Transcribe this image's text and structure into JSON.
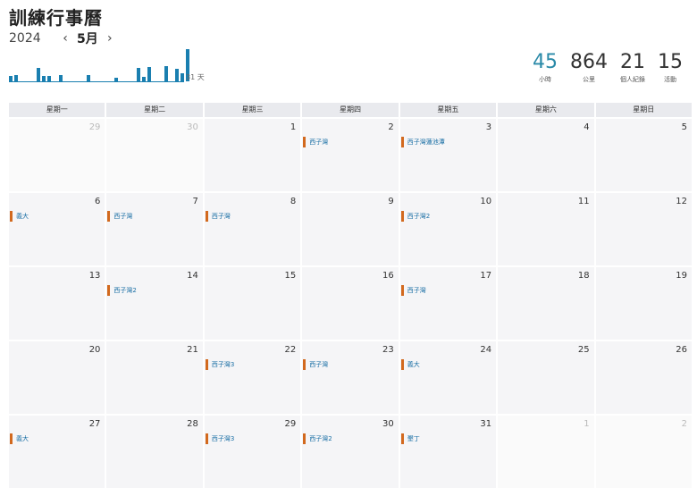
{
  "header": {
    "title": "訓練行事曆",
    "year": "2024",
    "month": "5月",
    "prev_icon": "chevron-left-icon",
    "next_icon": "chevron-right-icon"
  },
  "sparkline": {
    "label": "31 天",
    "values": [
      5,
      6,
      0,
      0,
      0,
      12,
      5,
      5,
      0,
      6,
      0,
      0,
      0,
      0,
      6,
      0,
      0,
      0,
      0,
      3,
      0,
      0,
      0,
      12,
      4,
      13,
      0,
      0,
      14,
      0,
      11,
      7,
      29
    ],
    "color": "#1a7fb0"
  },
  "stats": [
    {
      "value": "45",
      "label": "小時"
    },
    {
      "value": "864",
      "label": "公里"
    },
    {
      "value": "21",
      "label": "個人紀錄"
    },
    {
      "value": "15",
      "label": "活動"
    }
  ],
  "calendar": {
    "weekdays": [
      "星期一",
      "星期二",
      "星期三",
      "星期四",
      "星期五",
      "星期六",
      "星期日"
    ],
    "weeks": [
      [
        {
          "day": "29",
          "other": true
        },
        {
          "day": "30",
          "other": true
        },
        {
          "day": "1"
        },
        {
          "day": "2",
          "event": "西子灣"
        },
        {
          "day": "3",
          "event": "西子灣蓮池潭"
        },
        {
          "day": "4"
        },
        {
          "day": "5"
        }
      ],
      [
        {
          "day": "6",
          "event": "義大"
        },
        {
          "day": "7",
          "event": "西子灣"
        },
        {
          "day": "8",
          "event": "西子灣"
        },
        {
          "day": "9"
        },
        {
          "day": "10",
          "event": "西子灣2"
        },
        {
          "day": "11"
        },
        {
          "day": "12"
        }
      ],
      [
        {
          "day": "13"
        },
        {
          "day": "14",
          "event": "西子灣2"
        },
        {
          "day": "15"
        },
        {
          "day": "16"
        },
        {
          "day": "17",
          "event": "西子灣"
        },
        {
          "day": "18"
        },
        {
          "day": "19"
        }
      ],
      [
        {
          "day": "20"
        },
        {
          "day": "21"
        },
        {
          "day": "22",
          "event": "西子灣3"
        },
        {
          "day": "23",
          "event": "西子灣"
        },
        {
          "day": "24",
          "event": "義大"
        },
        {
          "day": "25"
        },
        {
          "day": "26"
        }
      ],
      [
        {
          "day": "27",
          "event": "義大"
        },
        {
          "day": "28"
        },
        {
          "day": "29",
          "event": "西子灣3"
        },
        {
          "day": "30",
          "event": "西子灣2"
        },
        {
          "day": "31",
          "event": "墾丁"
        },
        {
          "day": "1",
          "other": true
        },
        {
          "day": "2",
          "other": true
        }
      ]
    ],
    "event_accent": "#d2691e",
    "event_text_color": "#1a6fa5"
  }
}
